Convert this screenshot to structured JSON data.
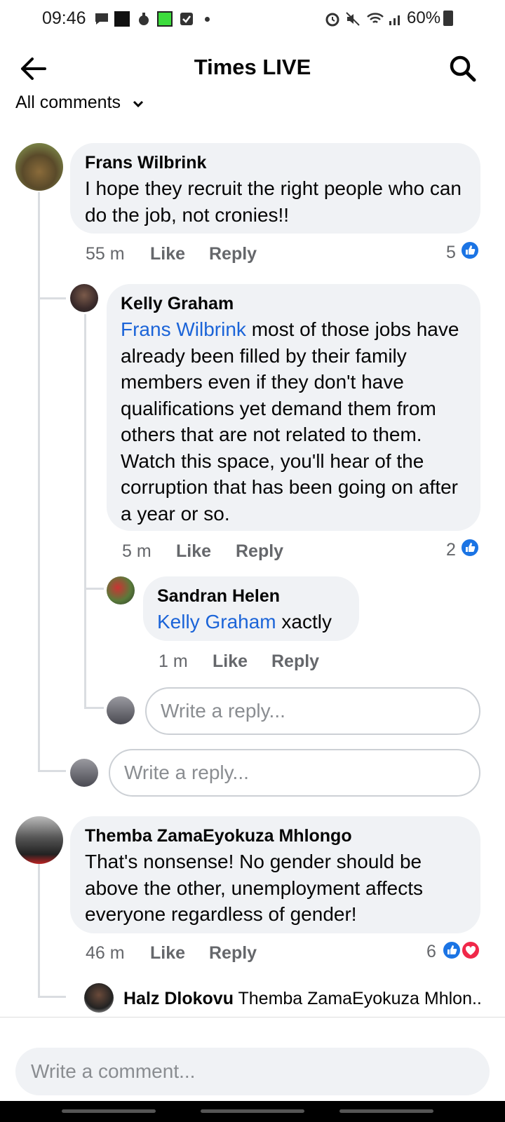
{
  "status": {
    "time": "09:46",
    "battery": "60%"
  },
  "header": {
    "title": "Times LIVE"
  },
  "filter": {
    "label": "All comments"
  },
  "comments": [
    {
      "name": "Frans Wilbrink",
      "text": "I hope they recruit the right people who can do the job, not cronies!!",
      "time": "55 m",
      "like": "Like",
      "reply": "Reply",
      "reactions": "5"
    },
    {
      "name": "Kelly Graham",
      "mention": "Frans Wilbrink",
      "text": " most of those jobs have already been filled by their family members even if they don't have qualifications yet demand them from others that are not related to them. Watch this space, you'll hear of the corruption that has been going on after a year or so.",
      "time": "5 m",
      "like": "Like",
      "reply": "Reply",
      "reactions": "2"
    },
    {
      "name": "Sandran Helen",
      "mention": "Kelly Graham",
      "text": " xactly",
      "time": "1 m",
      "like": "Like",
      "reply": "Reply"
    },
    {
      "name": "Themba ZamaEyokuza Mhlongo",
      "text": "That's nonsense! No gender should be above the other, unemployment affects everyone regardless of gender!",
      "time": "46 m",
      "like": "Like",
      "reply": "Reply",
      "reactions": "6"
    },
    {
      "name": "Halz Dlokovu",
      "preview": "Themba ZamaEyokuza Mhlon..."
    }
  ],
  "reply_placeholder": "Write a reply...",
  "comment_placeholder": "Write a comment..."
}
